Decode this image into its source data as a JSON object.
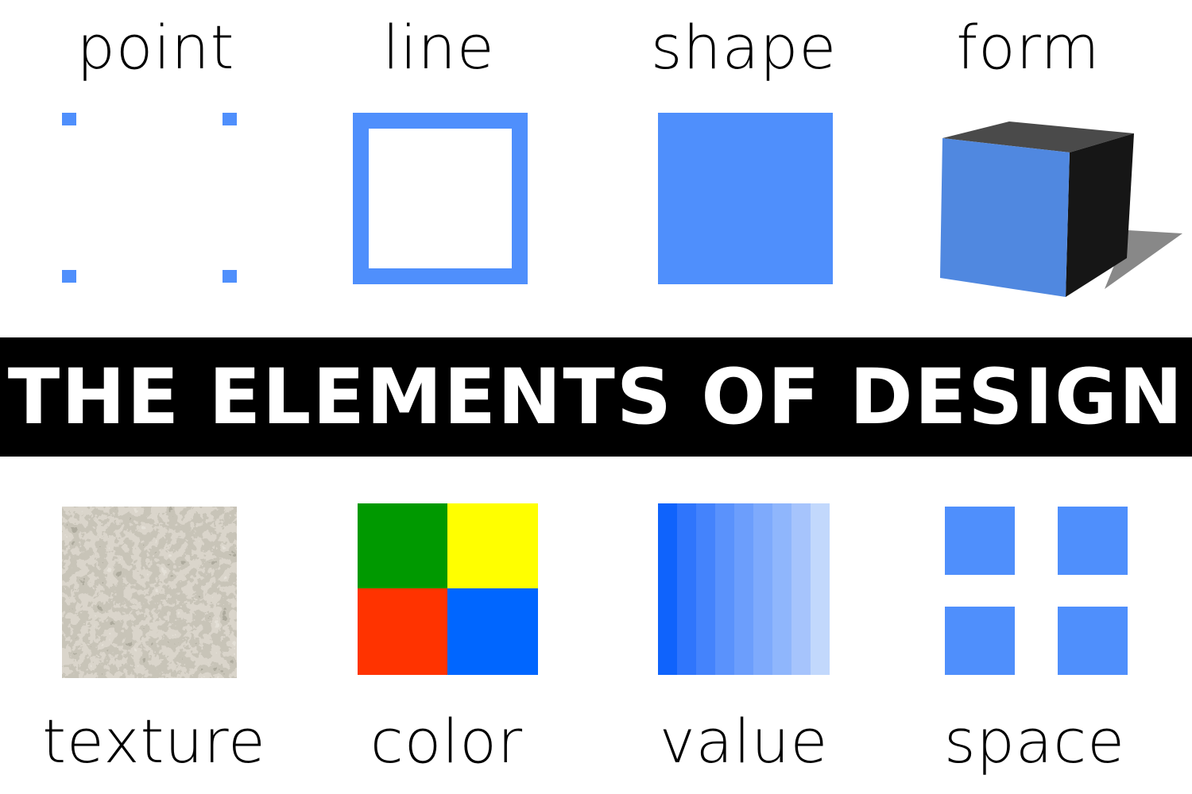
{
  "title": "THE ELEMENTS OF DESIGN",
  "colors": {
    "accent_blue": "#4f8ffc",
    "banner_bg": "#000000",
    "banner_text": "#ffffff",
    "cube_front": "#5088e0",
    "cube_top": "#4a4a4a",
    "cube_side": "#161616",
    "cube_shadow": "#888888",
    "color_green": "#009900",
    "color_yellow": "#ffff00",
    "color_red": "#ff3300",
    "color_blue": "#0066ff",
    "value_steps": [
      "#0f63fc",
      "#2f75fc",
      "#4483fc",
      "#5a92fc",
      "#6c9efc",
      "#7eaafc",
      "#8fb6fc",
      "#a6c4fc",
      "#c2d8fc"
    ]
  },
  "elements": {
    "point": "point",
    "line": "line",
    "shape": "shape",
    "form": "form",
    "texture": "texture",
    "color": "color",
    "value": "value",
    "space": "space"
  }
}
